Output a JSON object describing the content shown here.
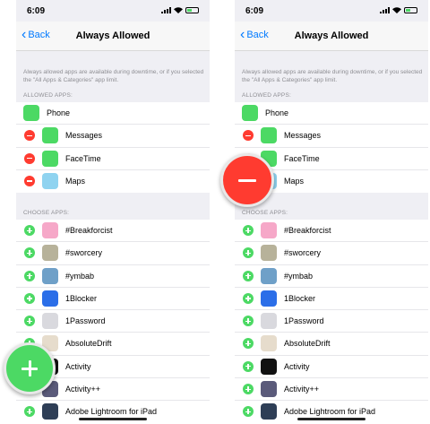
{
  "status_bar": {
    "time": "6:09"
  },
  "nav": {
    "back_label": "Back",
    "title": "Always Allowed"
  },
  "description": "Always allowed apps are available during downtime, or if you selected the \"All Apps & Categories\" app limit.",
  "sections": {
    "allowed_header": "ALLOWED APPS:",
    "choose_header": "CHOOSE APPS:"
  },
  "allowed_apps": [
    {
      "label": "Phone",
      "icon": "phone-icon",
      "color": "#4cd964"
    },
    {
      "label": "Messages",
      "icon": "messages-icon",
      "color": "#4cd964"
    },
    {
      "label": "FaceTime",
      "icon": "facetime-icon",
      "color": "#4cd964"
    },
    {
      "label": "Maps",
      "icon": "maps-icon",
      "color": "#8fd3f0"
    }
  ],
  "choose_apps": [
    {
      "label": "#Breakforcist",
      "icon": "breakforcist-icon",
      "color": "#f6a8c8"
    },
    {
      "label": "#sworcery",
      "icon": "sworcery-icon",
      "color": "#b7b29a"
    },
    {
      "label": "#ymbab",
      "icon": "ymbab-icon",
      "color": "#6fa0c8"
    },
    {
      "label": "1Blocker",
      "icon": "1blocker-icon",
      "color": "#2b6ee8"
    },
    {
      "label": "1Password",
      "icon": "1password-icon",
      "color": "#d9d9de"
    },
    {
      "label": "AbsoluteDrift",
      "icon": "absolutedrift-icon",
      "color": "#e6dccc"
    },
    {
      "label": "Activity",
      "icon": "activity-icon",
      "color": "#111111"
    },
    {
      "label": "Activity++",
      "icon": "activity-plus-icon",
      "color": "#5a5a7a"
    },
    {
      "label": "Adobe Lightroom for iPad",
      "icon": "lightroom-icon",
      "color": "#2e3e56"
    }
  ],
  "colors": {
    "accent": "#007aff",
    "remove": "#ff3b30",
    "add": "#4cd964"
  }
}
